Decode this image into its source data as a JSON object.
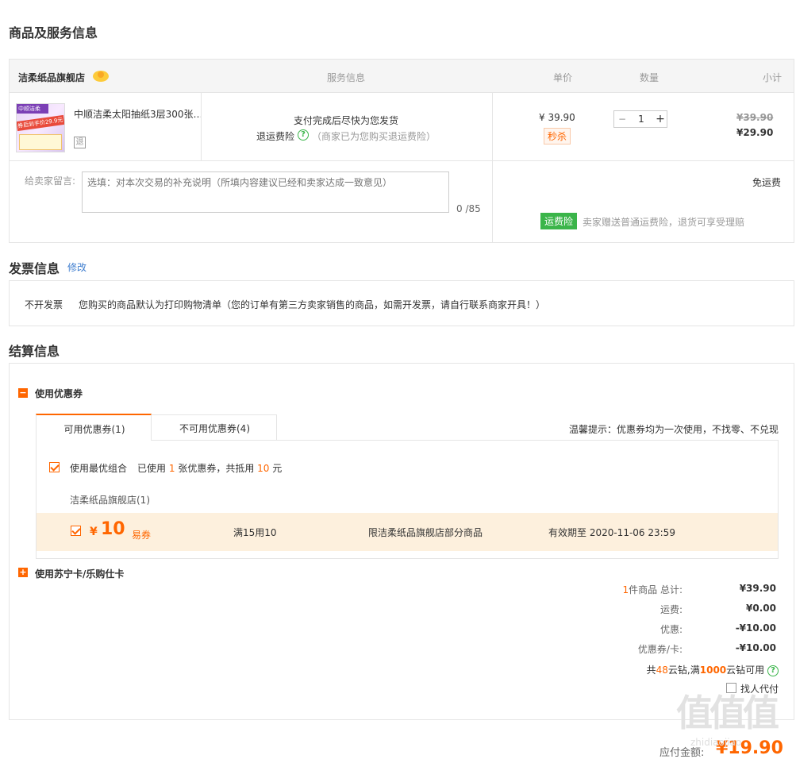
{
  "sections": {
    "goods_title": "商品及服务信息",
    "invoice_title": "发票信息",
    "invoice_edit": "修改",
    "settle_title": "结算信息"
  },
  "table": {
    "store_name": "洁柔纸品旗舰店",
    "col_service": "服务信息",
    "col_price": "单价",
    "col_qty": "数量",
    "col_subtotal": "小计"
  },
  "product": {
    "name": "中顺洁柔太阳抽纸3层300张…",
    "refund_tag": "退",
    "thumb_line1": "中顺洁柔",
    "thumb_line2": "券后到手价29.9元",
    "service_line1": "支付完成后尽快为您发货",
    "service_refund_label": "退运费险",
    "service_refund_note": "（商家已为您购买退运费险）",
    "price": "¥ 39.90",
    "seckill": "秒杀",
    "qty": "1",
    "qty_minus": "−",
    "qty_plus": "+",
    "subtotal_old": "¥39.90",
    "subtotal_new": "¥29.90"
  },
  "message": {
    "label": "给卖家留言:",
    "placeholder": "选填：对本次交易的补充说明（所填内容建议已经和卖家达成一致意见）",
    "counter": "0 /85",
    "shipping": "免运费",
    "insurance_badge": "运费险",
    "insurance_note": "卖家赠送普通运费险，退货可享受理赔"
  },
  "invoice": {
    "type": "不开发票",
    "desc": "您购买的商品默认为打印购物清单（您的订单有第三方卖家销售的商品，如需开发票，请自行联系商家开具！）"
  },
  "coupon": {
    "toggle": "−",
    "title": "使用优惠券",
    "tab_available": "可用优惠券(1)",
    "tab_unavailable": "不可用优惠券(4)",
    "tip": "温馨提示：优惠券均为一次使用，不找零、不兑现",
    "best_combo": "使用最优组合",
    "used_prefix": "已使用",
    "used_count": "1",
    "used_mid": "张优惠券，共抵用",
    "used_amount": "10",
    "used_suffix": "元",
    "store": "洁柔纸品旗舰店(1)",
    "item_currency": "¥",
    "item_amount": "10",
    "item_type": "易券",
    "item_rule": "满15用10",
    "item_scope": "限洁柔纸品旗舰店部分商品",
    "item_expiry": "有效期至 2020-11-06 23:59"
  },
  "card": {
    "toggle": "+",
    "title": "使用苏宁卡/乐购仕卡"
  },
  "summary": {
    "count": "1",
    "count_label": "件商品 总计:",
    "total": "¥39.90",
    "shipping_label": "运费:",
    "shipping": "¥0.00",
    "discount_label": "优惠:",
    "discount": "-¥10.00",
    "coupon_label": "优惠券/卡:",
    "coupon": "-¥10.00",
    "diamond_prefix": "共",
    "diamond_count": "48",
    "diamond_mid": "云钻,满",
    "diamond_need": "1000",
    "diamond_suffix": "云钻可用",
    "proxy_pay": "找人代付",
    "payable_label": "应付金额:",
    "payable": "¥19.90"
  },
  "watermark": {
    "top": "值",
    "bottom": "zhidiaojiao"
  }
}
